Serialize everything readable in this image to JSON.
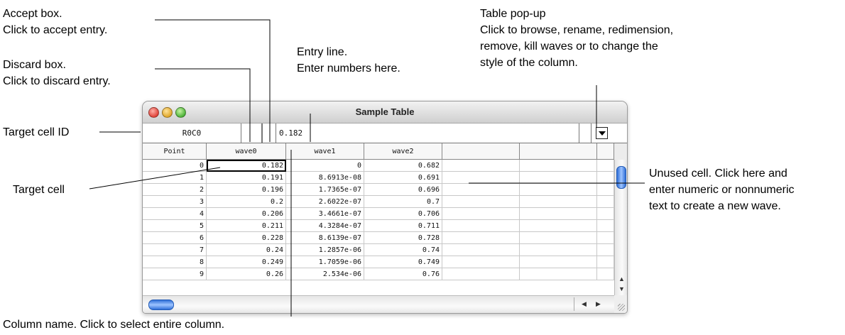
{
  "annotations": {
    "accept_box": [
      "Accept box.",
      "Click to accept entry."
    ],
    "discard_box": [
      "Discard box.",
      "Click to discard entry."
    ],
    "entry_line": [
      "Entry line.",
      "Enter numbers here."
    ],
    "table_popup": [
      "Table pop-up",
      "Click to browse, rename, redimension,",
      "remove, kill waves or to change the",
      "style of the column."
    ],
    "target_cell_id": "Target cell ID",
    "target_cell": "Target cell",
    "unused_cell": [
      "Unused cell. Click here and",
      "enter numeric or nonnumeric",
      "text to create a new wave."
    ],
    "column_name": "Column name. Click to select entire column."
  },
  "window": {
    "title": "Sample Table",
    "target_cell_id": "R0C0",
    "entry_value": "0.182"
  },
  "table": {
    "columns": [
      "Point",
      "wave0",
      "wave1",
      "wave2"
    ],
    "rows": [
      [
        "0",
        "0.182",
        "0",
        "0.682"
      ],
      [
        "1",
        "0.191",
        "8.6913e-08",
        "0.691"
      ],
      [
        "2",
        "0.196",
        "1.7365e-07",
        "0.696"
      ],
      [
        "3",
        "0.2",
        "2.6022e-07",
        "0.7"
      ],
      [
        "4",
        "0.206",
        "3.4661e-07",
        "0.706"
      ],
      [
        "5",
        "0.211",
        "4.3284e-07",
        "0.711"
      ],
      [
        "6",
        "0.228",
        "8.6139e-07",
        "0.728"
      ],
      [
        "7",
        "0.24",
        "1.2857e-06",
        "0.74"
      ],
      [
        "8",
        "0.249",
        "1.7059e-06",
        "0.749"
      ],
      [
        "9",
        "0.26",
        "2.534e-06",
        "0.76"
      ]
    ]
  },
  "icons": {
    "close": "close-icon",
    "minimize": "minimize-icon",
    "zoom": "zoom-icon",
    "popup": "chevron-down-icon",
    "resize": "resize-grip-icon"
  },
  "colors": {
    "close": "#e0443a",
    "minimize": "#e0a72a",
    "zoom": "#4fb33a",
    "scroll_thumb": "#2f6fd8"
  }
}
